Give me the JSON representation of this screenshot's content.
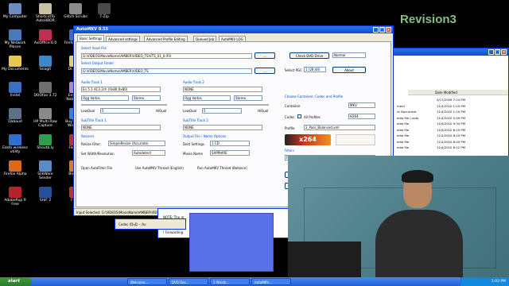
{
  "brand": {
    "logo_text": "Revision3"
  },
  "desktop_icons": [
    {
      "label": "My Computer",
      "color": "#6c8cc0"
    },
    {
      "label": "My Network Places",
      "color": "#4a78b8"
    },
    {
      "label": "My Documents",
      "color": "#e8c850"
    },
    {
      "label": "Inntel",
      "color": "#3d6fc0"
    },
    {
      "label": "Dabaud",
      "color": "#5f6f88"
    },
    {
      "label": "Eskfo wireless utility",
      "color": "#2f6fd0"
    },
    {
      "label": "Firefox Alpha",
      "color": "#d86a1c"
    },
    {
      "label": "AdobeRup 9 Free",
      "color": "#b8222a"
    },
    {
      "label": "ShortcutTo AutoHBOR",
      "color": "#c8c0a0"
    },
    {
      "label": "AviOffice 6.0",
      "color": "#c02f4f"
    },
    {
      "label": "Snagit",
      "color": "#3d88c8"
    },
    {
      "label": "DOOfoo 3.72",
      "color": "#6f6f6f"
    },
    {
      "label": "HP Multi-Raw Capture",
      "color": "#8a8a8a"
    },
    {
      "label": "Shoutb.ly",
      "color": "#2fa04a"
    },
    {
      "label": "SilkWare Sender",
      "color": "#5a8ac8"
    },
    {
      "label": "SHiF 2",
      "color": "#2a4f9a"
    },
    {
      "label": "Glitch Scrubs",
      "color": "#8c8c8c"
    },
    {
      "label": "Firefox Claim",
      "color": "#3c6cc0"
    },
    {
      "label": "Dr. Dhirt",
      "color": "#e0d070"
    },
    {
      "label": "Endnote Nation.jpg",
      "color": "#aa88cc"
    },
    {
      "label": "BuyTM4 for Windows",
      "color": "#3d7ed8"
    },
    {
      "label": "FileZilla",
      "color": "#b83030"
    },
    {
      "label": "Blender",
      "color": "#e07a20"
    },
    {
      "label": "Flash",
      "color": "#c03030"
    },
    {
      "label": "7-Zip",
      "color": "#4a4a4a"
    },
    {
      "label": "ProJeStu",
      "color": "#888888"
    },
    {
      "label": "HandBrake",
      "color": "#c05a20"
    },
    {
      "label": "ShortcutTo bonusc 6.1",
      "color": "#d0a040"
    },
    {
      "label": "Google Chrome",
      "color": "#d84a38"
    },
    {
      "label": "TeraCopy",
      "color": "#3d6fd0"
    },
    {
      "label": "DVDDecrypter",
      "color": "#9a9a9a"
    },
    {
      "label": "SlikBridge Windows",
      "color": "#6a8ac8"
    }
  ],
  "main_window": {
    "title": "AutoMKV 0.55",
    "tabs": [
      "Basic Settings",
      "Advanced settings",
      "Advanced Profile Editing",
      "Queued Job",
      "AutoMKV LOG"
    ],
    "select_input_label": "Select Input File",
    "input_value": "G:\\VIDEOS\\MovieName\\AMBER\\VIDEO_TS\\VTS_01_0.IFO",
    "select_output_label": "Select Output Folder",
    "output_value": "G:\\VIDEOS\\MovieName\\AMBER\\VIDEO_TS",
    "browse_label": "...",
    "check_dvd_label": "Check DVD Drive",
    "drive_value": "Normal",
    "select_pgc_label": "Select PGC",
    "pgc_value": "1 (28:44)",
    "about_label": "About",
    "audio1_label": "Audio Track 1",
    "audio1_value": "En 5.1 AC3 2ch (0x80:0x80)",
    "audio2_label": "Audio Track 2",
    "audio2_value": "NONE",
    "audio_codec": "Ogg Vorbis",
    "audio_mode": "Stereo",
    "low_qual": "LowQual",
    "hi_qual": "HiQual",
    "audio_q1": "5",
    "audio_q2": "5",
    "sub1_label": "SubTitle Track 1",
    "sub1_value": "NONE",
    "sub2_label": "SubTitle Track 2",
    "sub2_value": "NONE",
    "resizers_label": "Resizers",
    "resize_filter_label": "Resize Filter:",
    "resize_filter_value": "SimpleResize (Accurate)",
    "deinterlace_label": "Set Width/Resolution",
    "deinterlace_value": "Autodetect",
    "output_options_label": "Output File / Name Options",
    "dest_label": "Dest Settings",
    "dest_value": "1 CD",
    "movie_name_label": "Movie Name",
    "movie_name_value": "SAPPHIRE",
    "autofilter_label": "Open AutoFilter File",
    "bits_label": "Use AutoMKV Thread (English)",
    "thread_label": "Run AutoMKV Thread (Balance)",
    "container_group_label": "Choose Container, Codec and Profile",
    "container_label": "Container",
    "container_value": "MKV",
    "codec_label": "Codec",
    "codec_check_label": "All Profiles",
    "codec_value": "H264",
    "profile_label": "Profile",
    "profile_value": "2_Pass_Balanced.xml",
    "filter_label": "Filters",
    "filter_value": "FilterlessTelecide()",
    "add_queue_label": "Add to Queue",
    "start_encoding_label": "Start Encoding",
    "quit_label": "Quit",
    "status_text": "Input Selected: G:\\VIDEOS\\MovieName\\AMBER\\VIDEO_TS\\VTS_01_0.IFO",
    "logo_text": "x264"
  },
  "explorer_window": {
    "header_col": "Date Modified",
    "rows": [
      {
        "name": "",
        "date": "4/17/2009 7:24 PM"
      },
      {
        "name": "ment",
        "date": "11/4/2010 1:10 PM"
      },
      {
        "name": "nt Document",
        "date": "11/4/2010 1:10 PM"
      },
      {
        "name": "edia file (.vob)",
        "date": "11/4/2010 5:49 PM"
      },
      {
        "name": "edia file",
        "date": "11/4/2010 9:34 PM"
      },
      {
        "name": "edia file",
        "date": "11/4/2010 8:10 PM"
      },
      {
        "name": "edia file",
        "date": "11/4/2010 8:20 PM"
      },
      {
        "name": "edia file",
        "date": "11/4/2010 8:40 PM"
      },
      {
        "name": "edia file",
        "date": "11/4/2010 8:12 PM"
      }
    ]
  },
  "notepad_window": {
    "line1": "NOTE: The m",
    "line2": "get your new l",
    "line3": "! Forwarding"
  },
  "small_window": {
    "title_fragment": "Codec (DvD -- Au"
  },
  "taskbar": {
    "start_label": "start",
    "items": [
      "Welcome...",
      "DVD Dec...",
      "3 Windo...",
      "AutoMKV..."
    ],
    "clock": "1:02 PM"
  }
}
